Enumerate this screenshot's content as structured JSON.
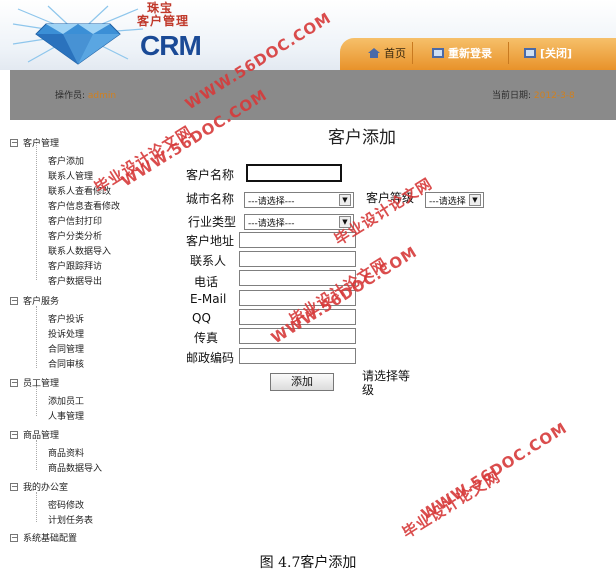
{
  "header": {
    "logo_cn_line1": "珠宝",
    "logo_cn_line2": "客户管理",
    "logo_en": "CRM",
    "nav": [
      {
        "label": "首页",
        "icon": "home-icon"
      },
      {
        "label": "重新登录",
        "icon": "relogin-icon"
      },
      {
        "label": "[关闭]",
        "icon": "close-icon"
      }
    ]
  },
  "status": {
    "operator_label": "操作员:",
    "operator_value": "admin",
    "date_label": "当前日期:",
    "date_value": "2012-3-8"
  },
  "sidebar": {
    "sections": [
      {
        "label": "客户管理",
        "items": [
          "客户添加",
          "联系人管理",
          "联系人查看修改",
          "客户信息查看修改",
          "客户信封打印",
          "客户分类分析",
          "联系人数据导入",
          "客户跟踪拜访",
          "客户数据导出"
        ]
      },
      {
        "label": "客户服务",
        "items": [
          "客户投诉",
          "投诉处理",
          "合同管理",
          "合同审核"
        ]
      },
      {
        "label": "员工管理",
        "items": [
          "添加员工",
          "人事管理"
        ]
      },
      {
        "label": "商品管理",
        "items": [
          "商品资料",
          "商品数据导入"
        ]
      },
      {
        "label": "我的办公室",
        "items": [
          "密码修改",
          "计划任务表"
        ]
      },
      {
        "label": "系统基础配置",
        "items": []
      }
    ]
  },
  "form": {
    "title": "客户添加",
    "fields": {
      "name_label": "客户名称",
      "city_label": "城市名称",
      "city_value": "---请选择---",
      "level_label": "客户等级",
      "level_value": "---请选择",
      "industry_label": "行业类型",
      "industry_value": "---请选择---",
      "address_label": "客户地址",
      "contact_label": "联系人",
      "phone_label": "电话",
      "email_label": "E-Mail",
      "qq_label": "QQ",
      "fax_label": "传真",
      "zip_label": "邮政编码"
    },
    "submit_label": "添加",
    "hint": "请选择等级"
  },
  "watermarks": [
    {
      "text": "WWW.56DOC.COM"
    },
    {
      "text": "毕业设计论文网"
    },
    {
      "text": "WWW.56DOC.COM"
    },
    {
      "text": "毕业设计论文网"
    },
    {
      "text": "WWW.56DOC.COM"
    },
    {
      "text": "毕业设计论文网"
    },
    {
      "text": "WWW.56DOC.COM"
    },
    {
      "text": "毕业设计论文网"
    }
  ],
  "caption": "图 4.7客户添加",
  "colors": {
    "accent_orange": "#e8922a",
    "brand_blue": "#1a4a96",
    "status_value": "#d08020",
    "watermark": "#d73a3a"
  }
}
